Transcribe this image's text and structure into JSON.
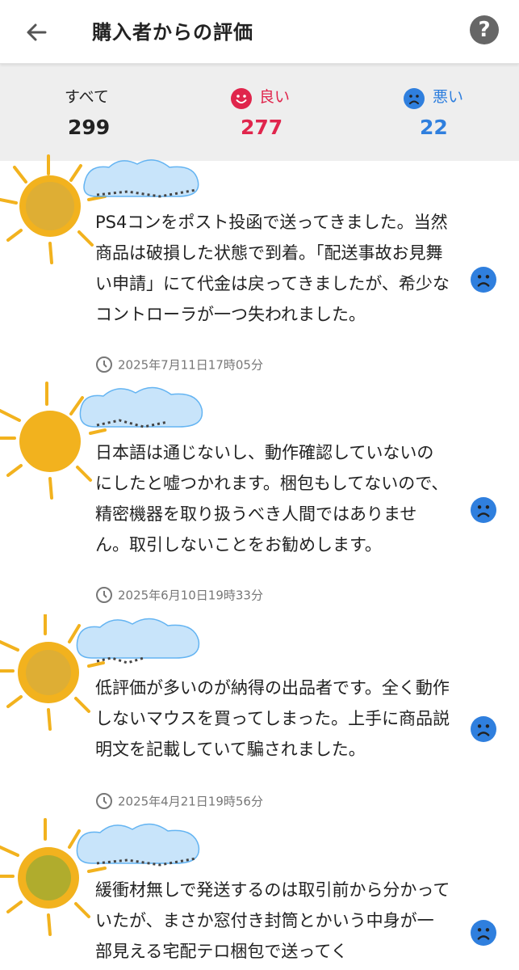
{
  "header": {
    "title": "購入者からの評価",
    "back_icon": "arrow-left-icon",
    "help_icon": "question-circle-icon"
  },
  "summary": {
    "all": {
      "label": "すべて",
      "count": "299"
    },
    "good": {
      "label": "良い",
      "count": "277",
      "icon": "smile-icon",
      "color": "#e0254c"
    },
    "bad": {
      "label": "悪い",
      "count": "22",
      "icon": "frown-icon",
      "color": "#2f7fde"
    }
  },
  "reviews": [
    {
      "comment": "PS4コンをポスト投函で送ってきました。当然商品は破損した状態で到着。「配送事故お見舞い申請」にて代金は戻ってきましたが、希少なコントローラが一つ失われました。",
      "date": "2025年7月11日17時05分",
      "rating": "bad"
    },
    {
      "comment": "日本語は通じないし、動作確認していないのにしたと嘘つかれます。梱包もしてないので、精密機器を取り扱うべき人間ではありません。取引しないことをお勧めします。",
      "date": "2025年6月10日19時33分",
      "rating": "bad"
    },
    {
      "comment": "低評価が多いのが納得の出品者です。全く動作しないマウスを買ってしまった。上手に商品説明文を記載していて騙されました。",
      "date": "2025年4月21日19時56分",
      "rating": "bad"
    },
    {
      "comment": "緩衝材無しで発送するのは取引前から分かっていたが、まさか窓付き封筒とかいう中身が一部見える宅配テロ梱包で送ってく",
      "date": "",
      "rating": "bad"
    }
  ]
}
